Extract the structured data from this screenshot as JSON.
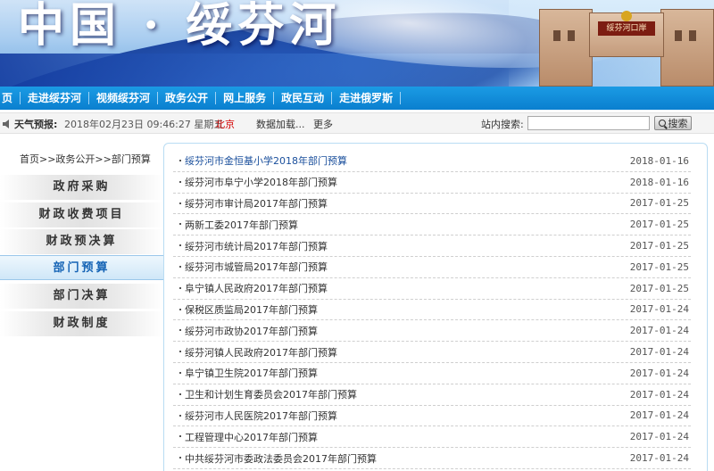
{
  "banner": {
    "title": "中国 · 绥芬河",
    "gate_sign": "绥芬河口岸"
  },
  "nav": {
    "items": [
      "页",
      "走进绥芬河",
      "视频绥芬河",
      "政务公开",
      "网上服务",
      "政民互动",
      "走进俄罗斯"
    ]
  },
  "infobar": {
    "weather_label": "天气预报:",
    "datetime": "2018年02月23日 09:46:27 星期五",
    "city": "北京",
    "loading": "数据加载...",
    "more": "更多",
    "search_label": "站内搜索:",
    "search_value": "",
    "search_button": "搜索"
  },
  "sidebar": {
    "breadcrumb": "首页>>政务公开>>部门预算",
    "items": [
      {
        "label": "政府采购",
        "active": false
      },
      {
        "label": "财政收费项目",
        "active": false
      },
      {
        "label": "财政预决算",
        "active": false
      },
      {
        "label": "部门预算",
        "active": true
      },
      {
        "label": "部门决算",
        "active": false
      },
      {
        "label": "财政制度",
        "active": false
      }
    ]
  },
  "list": {
    "rows": [
      {
        "title": "绥芬河市金恒基小学2018年部门预算",
        "date": "2018-01-16"
      },
      {
        "title": "绥芬河市阜宁小学2018年部门预算",
        "date": "2018-01-16"
      },
      {
        "title": "绥芬河市审计局2017年部门预算",
        "date": "2017-01-25"
      },
      {
        "title": "两新工委2017年部门预算",
        "date": "2017-01-25"
      },
      {
        "title": "绥芬河市统计局2017年部门预算",
        "date": "2017-01-25"
      },
      {
        "title": "绥芬河市城管局2017年部门预算",
        "date": "2017-01-25"
      },
      {
        "title": "阜宁镇人民政府2017年部门预算",
        "date": "2017-01-25"
      },
      {
        "title": "保税区质监局2017年部门预算",
        "date": "2017-01-24"
      },
      {
        "title": "绥芬河市政协2017年部门预算",
        "date": "2017-01-24"
      },
      {
        "title": "绥芬河镇人民政府2017年部门预算",
        "date": "2017-01-24"
      },
      {
        "title": "阜宁镇卫生院2017年部门预算",
        "date": "2017-01-24"
      },
      {
        "title": "卫生和计划生育委员会2017年部门预算",
        "date": "2017-01-24"
      },
      {
        "title": "绥芬河市人民医院2017年部门预算",
        "date": "2017-01-24"
      },
      {
        "title": "工程管理中心2017年部门预算",
        "date": "2017-01-24"
      },
      {
        "title": "中共绥芬河市委政法委员会2017年部门预算",
        "date": "2017-01-24"
      }
    ]
  }
}
